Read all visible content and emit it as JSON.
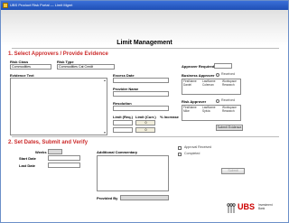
{
  "window": {
    "title": "UBS Product Risk Portal — Limit Mgmt"
  },
  "page": {
    "title": "Limit Management"
  },
  "section1": {
    "heading": "1. Select Approvers / Provide Evidence",
    "risk_class_label": "Risk Class",
    "risk_class_value": "Commodities",
    "risk_type_label": "Risk Type",
    "risk_type_value": "Commodities Cat Credit",
    "approver_required_label": "Approver Required",
    "evidence_text_label": "Evidence Text",
    "excess_date_label": "Excess Date",
    "provider_name_label": "Provider Name",
    "resolution_label": "Resolution",
    "limit_req_label": "Limit (Req.)",
    "limit_curr_label": "Limit (Curr.)",
    "pct_increase_label": "% Increase",
    "limit_curr_value_1": "0",
    "limit_curr_value_2": "0",
    "business_approver": {
      "label": "Business Approver",
      "received_label": "Received",
      "columns": [
        "FirstName",
        "LastName",
        "Workspace"
      ],
      "row": [
        "Daniel",
        "Coleman",
        "Research"
      ]
    },
    "risk_approver": {
      "label": "Risk Approver",
      "received_label": "Received",
      "columns": [
        "FirstName",
        "LastName",
        "Workspace"
      ],
      "row": [
        "Mike",
        "Sylvia",
        "Research"
      ]
    },
    "submit_button": "Submit Evidence"
  },
  "section2": {
    "heading": "2. Set Dates, Submit and Verify",
    "weeks_label": "Weeks",
    "start_date_label": "Start Date",
    "last_date_label": "Last Date",
    "additional_commentary_label": "Additional Commentary",
    "approval_received_label": "Approval Received",
    "completed_label": "Completed",
    "provided_by_label": "Provided By",
    "submit_button": "Submit"
  },
  "logo": {
    "text": "UBS",
    "subtitle_1": "Investment",
    "subtitle_2": "Bank"
  },
  "colors": {
    "section_heading": "#cc2a2a",
    "titlebar": "#1f4fb5",
    "logo": "#cc0000"
  }
}
